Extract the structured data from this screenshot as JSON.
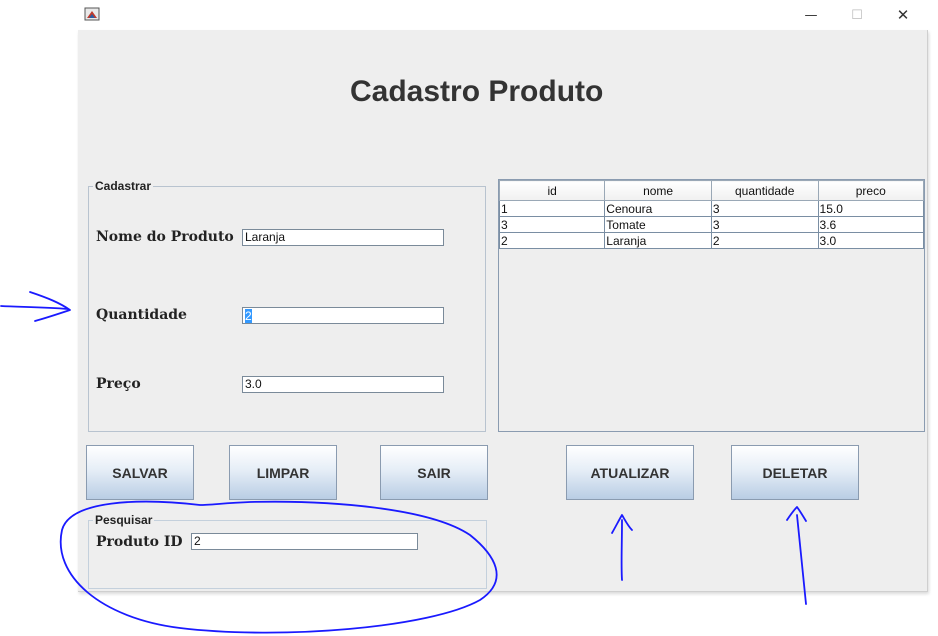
{
  "window": {
    "minimize_icon": "minimize-icon",
    "maximize_icon": "maximize-icon",
    "close_icon": "close-icon",
    "minimize_glyph": "—",
    "maximize_glyph": "☐",
    "close_glyph": "✕"
  },
  "page": {
    "title": "Cadastro Produto"
  },
  "cadastrar": {
    "legend": "Cadastrar",
    "nome_label": "Nome do Produto",
    "nome_value": "Laranja",
    "quantidade_label": "Quantidade",
    "quantidade_value": "2",
    "preco_label": "Preço",
    "preco_value": "3.0"
  },
  "buttons": {
    "salvar": "SALVAR",
    "limpar": "LIMPAR",
    "sair": "SAIR",
    "atualizar": "ATUALIZAR",
    "deletar": "DELETAR"
  },
  "pesquisar": {
    "legend": "Pesquisar",
    "produto_id_label": "Produto ID",
    "produto_id_value": "2"
  },
  "table": {
    "columns": [
      "id",
      "nome",
      "quantidade",
      "preco"
    ],
    "rows": [
      [
        "1",
        "Cenoura",
        "3",
        "15.0"
      ],
      [
        "3",
        "Tomate",
        "3",
        "3.6"
      ],
      [
        "2",
        "Laranja",
        "2",
        "3.0"
      ]
    ]
  },
  "colors": {
    "annotation_ink": "#1a1aff",
    "button_gradient_bottom": "#b9cde4"
  }
}
